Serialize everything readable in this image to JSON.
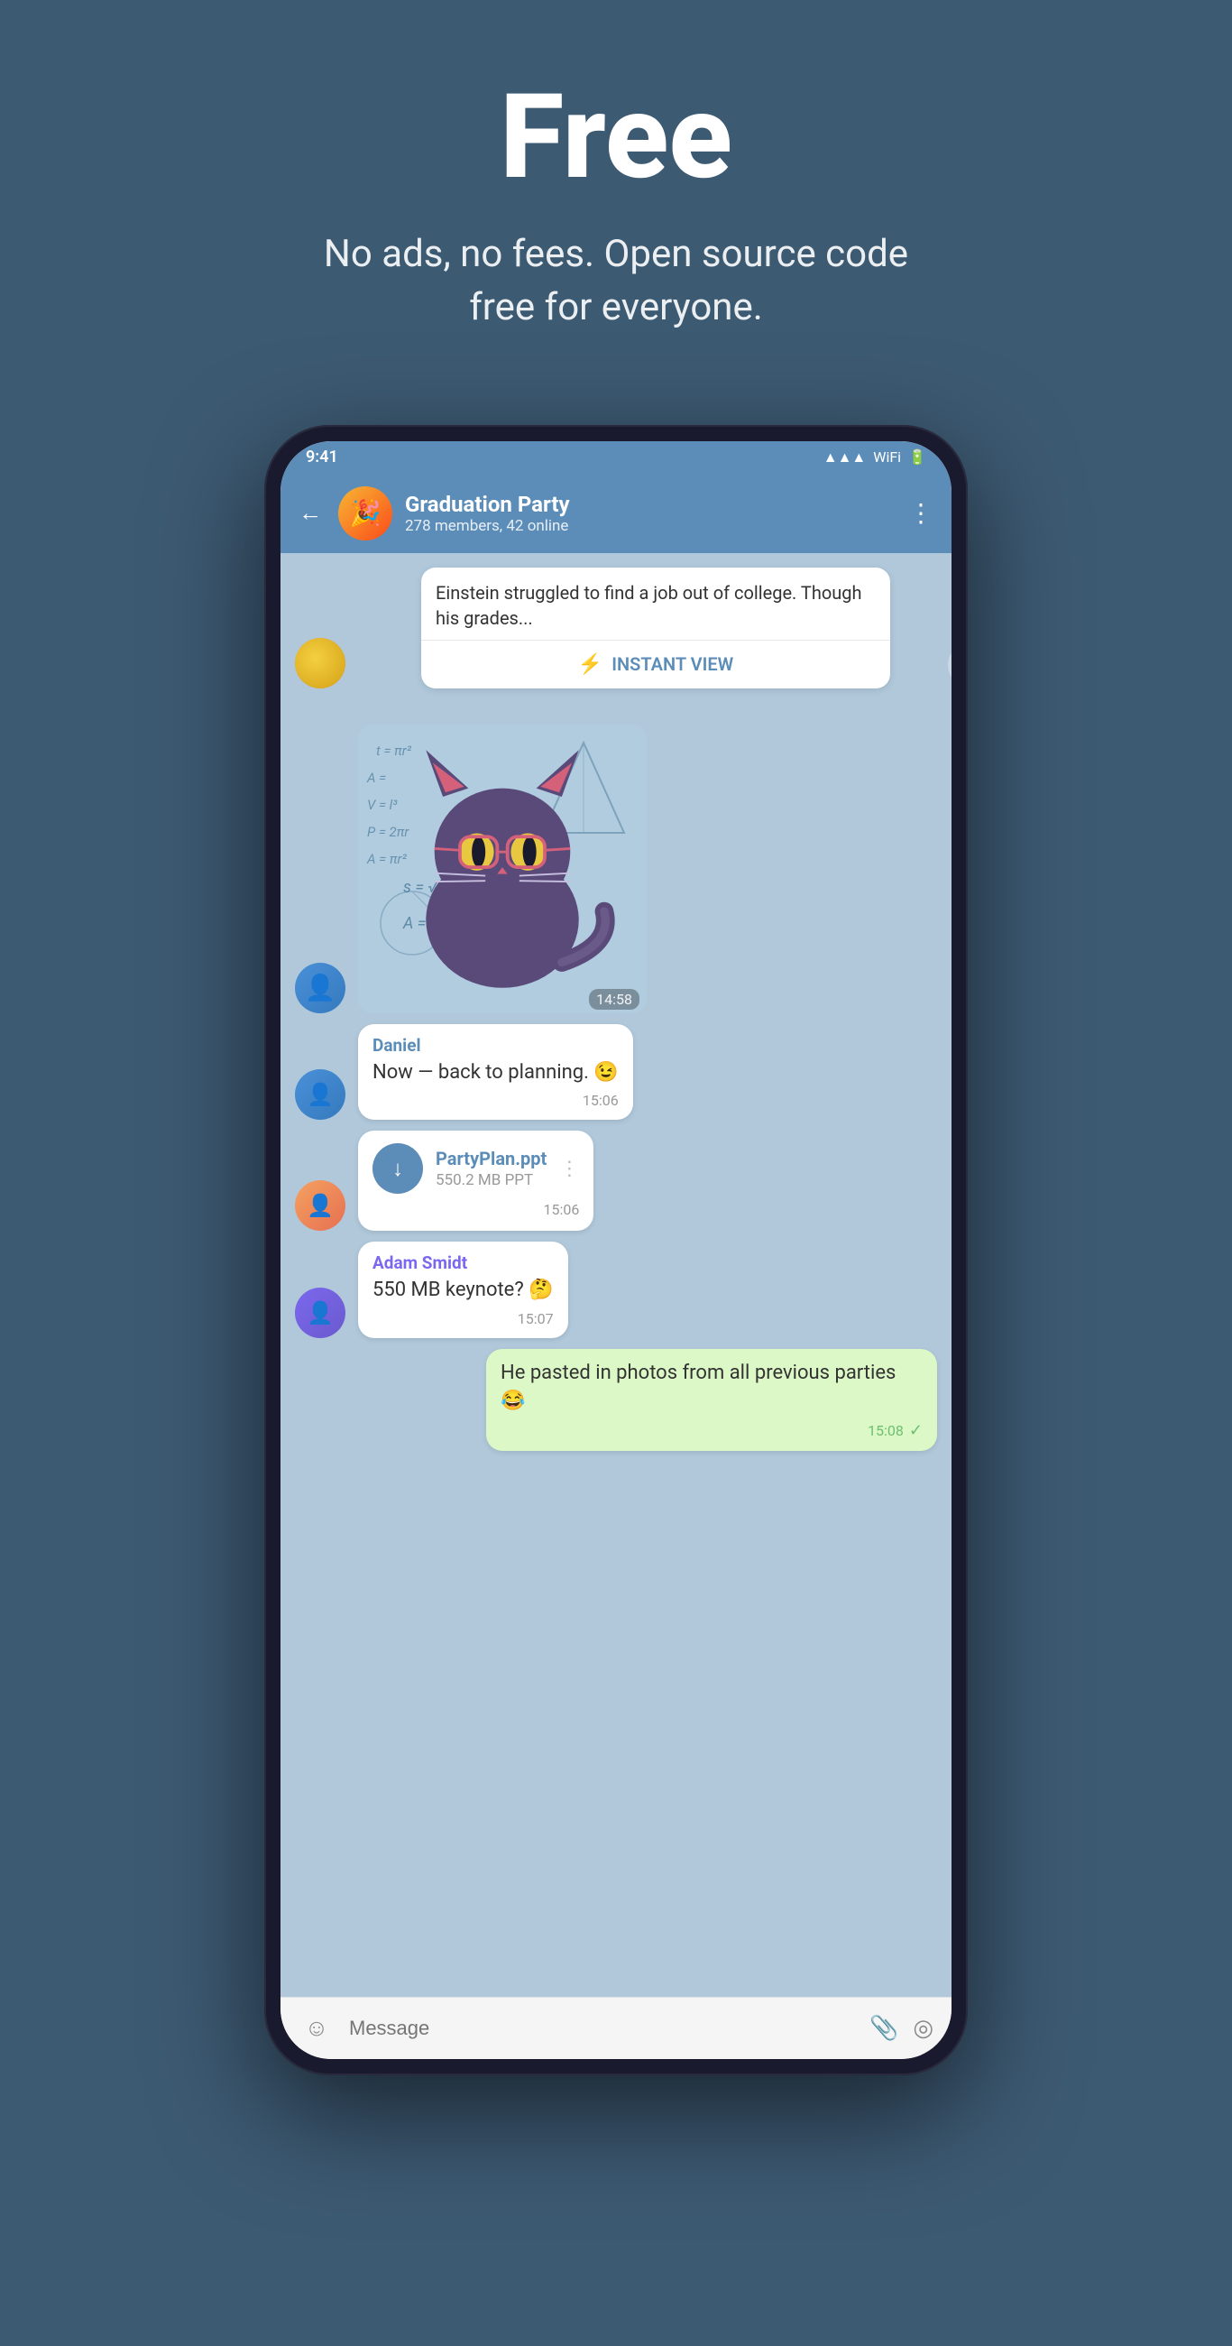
{
  "hero": {
    "title": "Free",
    "subtitle": "No ads, no fees. Open source code free for everyone."
  },
  "header": {
    "back": "←",
    "group_name": "Graduation Party",
    "group_status": "278 members, 42 online",
    "menu": "⋮"
  },
  "instant_view": {
    "text": "Einstein struggled to find a job out of college. Though his grades...",
    "button_label": "INSTANT VIEW"
  },
  "sticker": {
    "time": "14:58"
  },
  "messages": [
    {
      "sender": "Daniel",
      "text": "Now — back to planning. 😉",
      "time": "15:06",
      "type": "text",
      "side": "left"
    },
    {
      "type": "file",
      "file_name": "PartyPlan.ppt",
      "file_size": "550.2 MB PPT",
      "time": "15:06",
      "side": "left"
    },
    {
      "sender": "Adam Smidt",
      "text": "550 MB keynote? 🤔",
      "time": "15:07",
      "type": "text",
      "side": "left",
      "sender_color": "adam"
    },
    {
      "text": "He pasted in photos from all previous parties 😂",
      "time": "15:08",
      "type": "text",
      "side": "right",
      "bubble_class": "green"
    }
  ],
  "input_bar": {
    "placeholder": "Message",
    "emoji_icon": "☺",
    "attach_icon": "📎",
    "camera_icon": "◎"
  }
}
